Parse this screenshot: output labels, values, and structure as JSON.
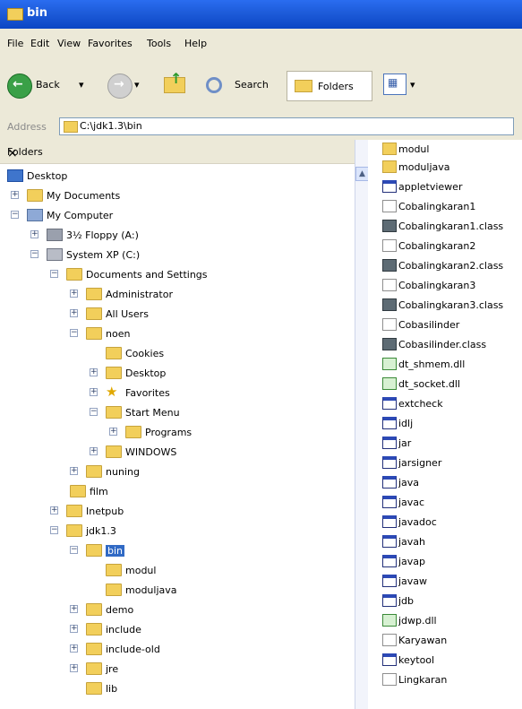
{
  "window": {
    "title": "bin"
  },
  "menu": {
    "items": [
      "File",
      "Edit",
      "View",
      "Favorites",
      "Tools",
      "Help"
    ]
  },
  "toolbar": {
    "back_label": "Back",
    "search_label": "Search",
    "folders_label": "Folders"
  },
  "address": {
    "label": "Address",
    "value": "C:\\jdk1.3\\bin"
  },
  "folders_pane": {
    "title": "Folders"
  },
  "tree": [
    {
      "label": "Desktop",
      "icon": "desktop-icon"
    },
    {
      "label": "My Documents",
      "icon": "folder-icon"
    },
    {
      "label": "My Computer",
      "icon": "computer-icon"
    },
    {
      "label": "3½ Floppy (A:)",
      "icon": "floppy-icon"
    },
    {
      "label": "System XP (C:)",
      "icon": "drive-icon"
    },
    {
      "label": "Documents and Settings",
      "icon": "folder-icon"
    },
    {
      "label": "Administrator",
      "icon": "folder-icon"
    },
    {
      "label": "All Users",
      "icon": "folder-icon"
    },
    {
      "label": "noen",
      "icon": "folder-icon"
    },
    {
      "label": "Cookies",
      "icon": "folder-icon"
    },
    {
      "label": "Desktop",
      "icon": "folder-icon"
    },
    {
      "label": "Favorites",
      "icon": "star-icon"
    },
    {
      "label": "Start Menu",
      "icon": "folder-icon"
    },
    {
      "label": "Programs",
      "icon": "programs-icon"
    },
    {
      "label": "WINDOWS",
      "icon": "folder-icon"
    },
    {
      "label": "nuning",
      "icon": "folder-icon"
    },
    {
      "label": "film",
      "icon": "folder-icon"
    },
    {
      "label": "Inetpub",
      "icon": "folder-icon"
    },
    {
      "label": "jdk1.3",
      "icon": "folder-icon"
    },
    {
      "label": "bin",
      "icon": "folder-icon"
    },
    {
      "label": "modul",
      "icon": "folder-icon"
    },
    {
      "label": "moduljava",
      "icon": "folder-icon"
    },
    {
      "label": "demo",
      "icon": "folder-icon"
    },
    {
      "label": "include",
      "icon": "folder-icon"
    },
    {
      "label": "include-old",
      "icon": "folder-icon"
    },
    {
      "label": "jre",
      "icon": "folder-icon"
    },
    {
      "label": "lib",
      "icon": "folder-icon"
    }
  ],
  "files": [
    {
      "name": "modul",
      "icon": "folder-icon"
    },
    {
      "name": "moduljava",
      "icon": "folder-icon"
    },
    {
      "name": "appletviewer",
      "icon": "app-icon"
    },
    {
      "name": "Cobalingkaran1",
      "icon": "doc-icon"
    },
    {
      "name": "Cobalingkaran1.class",
      "icon": "class-icon"
    },
    {
      "name": "Cobalingkaran2",
      "icon": "doc-icon"
    },
    {
      "name": "Cobalingkaran2.class",
      "icon": "class-icon"
    },
    {
      "name": "Cobalingkaran3",
      "icon": "doc-icon"
    },
    {
      "name": "Cobalingkaran3.class",
      "icon": "class-icon"
    },
    {
      "name": "Cobasilinder",
      "icon": "doc-icon"
    },
    {
      "name": "Cobasilinder.class",
      "icon": "class-icon"
    },
    {
      "name": "dt_shmem.dll",
      "icon": "dll-icon"
    },
    {
      "name": "dt_socket.dll",
      "icon": "dll-icon"
    },
    {
      "name": "extcheck",
      "icon": "app-icon"
    },
    {
      "name": "idlj",
      "icon": "app-icon"
    },
    {
      "name": "jar",
      "icon": "app-icon"
    },
    {
      "name": "jarsigner",
      "icon": "app-icon"
    },
    {
      "name": "java",
      "icon": "app-icon"
    },
    {
      "name": "javac",
      "icon": "app-icon"
    },
    {
      "name": "javadoc",
      "icon": "app-icon"
    },
    {
      "name": "javah",
      "icon": "app-icon"
    },
    {
      "name": "javap",
      "icon": "app-icon"
    },
    {
      "name": "javaw",
      "icon": "app-icon"
    },
    {
      "name": "jdb",
      "icon": "app-icon"
    },
    {
      "name": "jdwp.dll",
      "icon": "dll-icon"
    },
    {
      "name": "Karyawan",
      "icon": "doc-icon"
    },
    {
      "name": "keytool",
      "icon": "app-icon"
    },
    {
      "name": "Lingkaran",
      "icon": "doc-icon"
    }
  ]
}
